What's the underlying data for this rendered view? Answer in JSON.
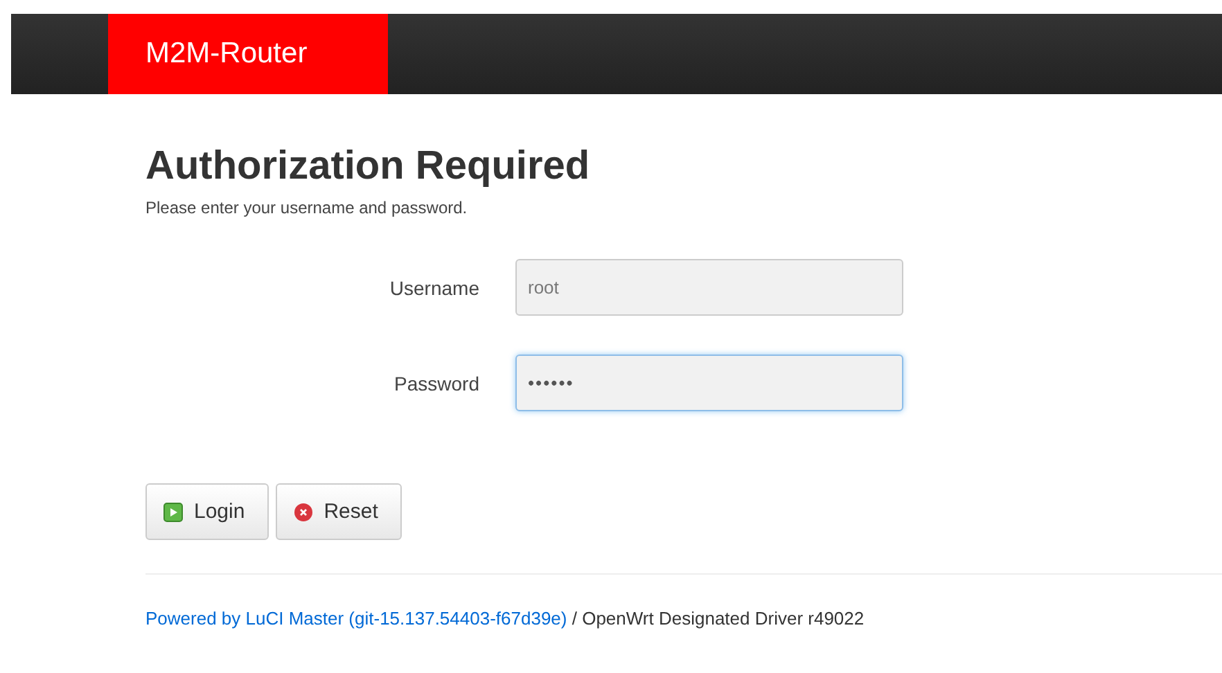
{
  "header": {
    "brand": "M2M-Router"
  },
  "title": "Authorization Required",
  "subtitle": "Please enter your username and password.",
  "fields": [
    {
      "label": "Username",
      "value": "root",
      "focused": false,
      "kind": "text"
    },
    {
      "label": "Password",
      "value": "••••••",
      "focused": true,
      "kind": "password"
    }
  ],
  "buttons": [
    {
      "label": "Login",
      "kind": "login"
    },
    {
      "label": "Reset",
      "kind": "reset"
    }
  ],
  "footer": {
    "link": "Powered by LuCI Master (git-15.137.54403-f67d39e)",
    "text": " / OpenWrt Designated Driver r49022"
  }
}
